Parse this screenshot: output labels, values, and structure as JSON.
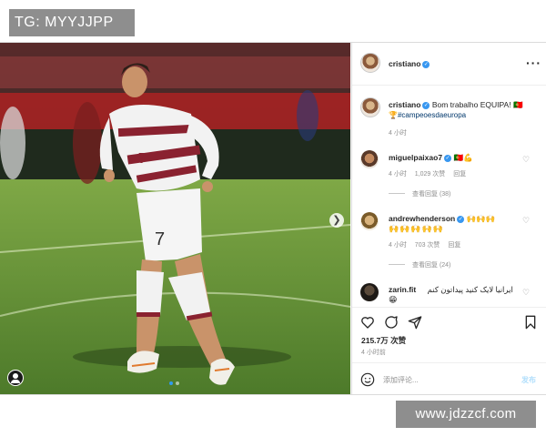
{
  "watermarks": {
    "top_left": "TG: MYYJJPP",
    "bottom_right": "www.jdzzcf.com"
  },
  "post": {
    "author": "cristiano",
    "caption_text": "Bom trabalho EQUIPA! 🇵🇹",
    "caption_hashtag": "🏆#campeoesdaeuropa",
    "caption_time": "4 小时",
    "jersey_number": "7",
    "carousel": {
      "current": 1,
      "total": 2
    },
    "icons": {
      "next": "chevron-right-icon",
      "tag": "user-tag-icon"
    },
    "colors": {
      "verified": "#3897f0",
      "link": "#00376b",
      "post_button": "#b2dffc",
      "muted": "#8e8e8e"
    }
  },
  "comments": [
    {
      "user": "miguelpaixao7",
      "text": "🇵🇹💪",
      "time": "4 小时",
      "likes": "1,029 次赞",
      "reply": "回复",
      "view_replies": "查看回复 (38)"
    },
    {
      "user": "andrewhenderson",
      "text": "🙌🙌🙌",
      "text2": "🙌🙌🙌🙌🙌",
      "time": "4 小时",
      "likes": "703 次赞",
      "reply": "回复",
      "view_replies": "查看回复 (24)"
    },
    {
      "user": "zarin.fit",
      "text": "ایرانیا لایک کنید پیداتون کنم",
      "text2": "😁"
    }
  ],
  "footer": {
    "likes": "215.7万 次赞",
    "time": "4 小时前",
    "add_comment_placeholder": "添加评论...",
    "post_button": "发布"
  }
}
